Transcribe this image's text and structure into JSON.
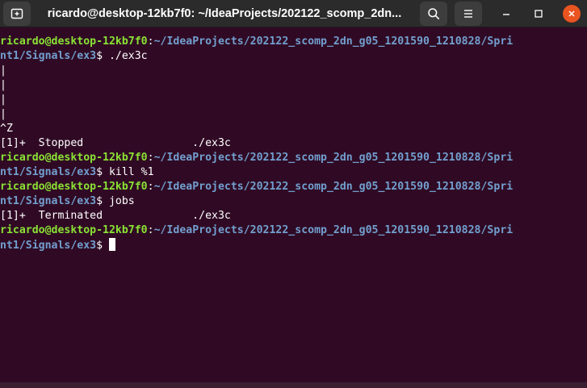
{
  "window": {
    "title": "ricardo@desktop-12kb7f0: ~/IdeaProjects/202122_scomp_2dn...",
    "new_tab_icon": "new-tab-icon",
    "search_icon": "search-icon",
    "menu_icon": "hamburger-menu-icon",
    "minimize_icon": "minimize-icon",
    "maximize_icon": "maximize-icon",
    "close_icon": "close-icon",
    "close_color": "#e95420"
  },
  "colors": {
    "background": "#300a24",
    "prompt_user": "#8ae234",
    "prompt_path": "#729fcf",
    "text": "#ffffff"
  },
  "terminal": {
    "lines": [
      {
        "user": "ricardo@desktop-12kb7f0",
        "sep": ":",
        "path": "~/IdeaProjects/202122_scomp_2dn_g05_1201590_1210828/Spri",
        "text": ""
      },
      {
        "user": "",
        "sep": "",
        "path": "nt1/Signals/ex3",
        "text": "$ ./ex3c"
      },
      {
        "user": "",
        "sep": "",
        "path": "",
        "text": "|"
      },
      {
        "user": "",
        "sep": "",
        "path": "",
        "text": "|"
      },
      {
        "user": "",
        "sep": "",
        "path": "",
        "text": "|"
      },
      {
        "user": "",
        "sep": "",
        "path": "",
        "text": "|"
      },
      {
        "user": "",
        "sep": "",
        "path": "",
        "text": "^Z"
      },
      {
        "user": "",
        "sep": "",
        "path": "",
        "text": "[1]+  Stopped                 ./ex3c"
      },
      {
        "user": "ricardo@desktop-12kb7f0",
        "sep": ":",
        "path": "~/IdeaProjects/202122_scomp_2dn_g05_1201590_1210828/Spri",
        "text": ""
      },
      {
        "user": "",
        "sep": "",
        "path": "nt1/Signals/ex3",
        "text": "$ kill %1"
      },
      {
        "user": "ricardo@desktop-12kb7f0",
        "sep": ":",
        "path": "~/IdeaProjects/202122_scomp_2dn_g05_1201590_1210828/Spri",
        "text": ""
      },
      {
        "user": "",
        "sep": "",
        "path": "nt1/Signals/ex3",
        "text": "$ jobs"
      },
      {
        "user": "",
        "sep": "",
        "path": "",
        "text": "[1]+  Terminated              ./ex3c"
      },
      {
        "user": "ricardo@desktop-12kb7f0",
        "sep": ":",
        "path": "~/IdeaProjects/202122_scomp_2dn_g05_1201590_1210828/Spri",
        "text": ""
      },
      {
        "user": "",
        "sep": "",
        "path": "nt1/Signals/ex3",
        "text": "$ "
      }
    ]
  }
}
